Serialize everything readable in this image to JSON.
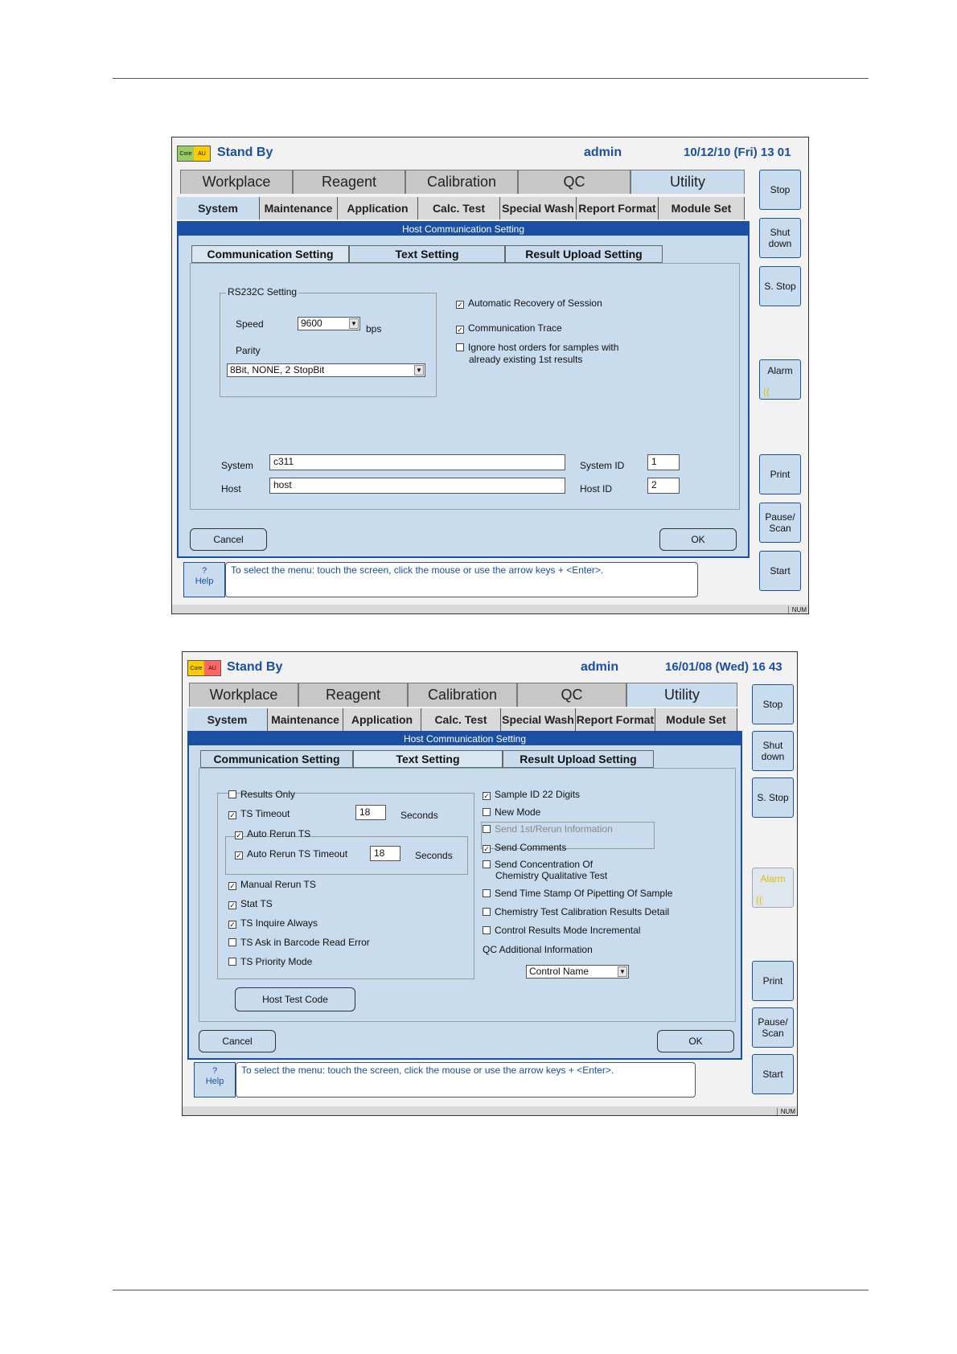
{
  "screen1": {
    "logo": {
      "left": "Core",
      "right": "AU"
    },
    "status": "Stand By",
    "user": "admin",
    "datetime": "10/12/10 (Fri) 13 01",
    "main_tabs": [
      "Workplace",
      "Reagent",
      "Calibration",
      "QC",
      "Utility"
    ],
    "sub_tabs": [
      "System",
      "Maintenance",
      "Application",
      "Calc. Test",
      "Special Wash",
      "Report Format",
      "Module Set"
    ],
    "dialog_title": "Host Communication Setting",
    "dialog_tabs": [
      "Communication Setting",
      "Text Setting",
      "Result Upload Setting"
    ],
    "rs232c": {
      "group_label": "RS232C Setting",
      "speed_label": "Speed",
      "speed_value": "9600",
      "speed_unit": "bps",
      "parity_label": "Parity",
      "parity_value": "8Bit, NONE, 2 StopBit"
    },
    "options": [
      {
        "label": "Automatic Recovery of Session",
        "checked": true
      },
      {
        "label": "Communication Trace",
        "checked": true
      },
      {
        "label": "Ignore host orders for samples with",
        "label2": "already existing 1st results",
        "checked": false
      }
    ],
    "system_label": "System",
    "system_value": "c311",
    "host_label": "Host",
    "host_value": "host",
    "system_id_label": "System ID",
    "system_id_value": "1",
    "host_id_label": "Host ID",
    "host_id_value": "2",
    "cancel_label": "Cancel",
    "ok_label": "OK",
    "help_label": "Help",
    "help_q": "?",
    "message": "To select the menu: touch the screen, click the mouse or use the arrow keys + <Enter>.",
    "side_buttons": [
      "Stop",
      "Shut down",
      "S. Stop",
      "Alarm",
      "Print",
      "Pause/ Scan",
      "Start"
    ],
    "num_indicator": "NUM"
  },
  "screen2": {
    "logo": {
      "left": "Core",
      "right": "AU"
    },
    "status": "Stand By",
    "user": "admin",
    "datetime": "16/01/08 (Wed) 16 43",
    "main_tabs": [
      "Workplace",
      "Reagent",
      "Calibration",
      "QC",
      "Utility"
    ],
    "sub_tabs": [
      "System",
      "Maintenance",
      "Application",
      "Calc. Test",
      "Special Wash",
      "Report Format",
      "Module Set"
    ],
    "dialog_title": "Host Communication Setting",
    "dialog_tabs": [
      "Communication Setting",
      "Text Setting",
      "Result Upload Setting"
    ],
    "left_options": {
      "results_only": {
        "label": "Results Only",
        "checked": false
      },
      "ts_timeout": {
        "label": "TS Timeout",
        "checked": true,
        "value": "18",
        "unit": "Seconds"
      },
      "auto_rerun_ts": {
        "label": "Auto Rerun TS",
        "checked": true
      },
      "auto_rerun_ts_timeout": {
        "label": "Auto Rerun TS Timeout",
        "checked": true,
        "value": "18",
        "unit": "Seconds"
      },
      "manual_rerun_ts": {
        "label": "Manual Rerun TS",
        "checked": true
      },
      "stat_ts": {
        "label": "Stat TS",
        "checked": true
      },
      "ts_inquire_always": {
        "label": "TS Inquire Always",
        "checked": true
      },
      "ts_ask_barcode": {
        "label": "TS Ask in Barcode Read Error",
        "checked": false
      },
      "ts_priority_mode": {
        "label": "TS Priority Mode",
        "checked": false
      }
    },
    "host_test_code_label": "Host Test Code",
    "right_options": {
      "sample_id_22": {
        "label": "Sample ID 22 Digits",
        "checked": true
      },
      "new_mode": {
        "label": "New Mode",
        "checked": false
      },
      "send_1st_rerun": {
        "label": "Send 1st/Rerun Information",
        "checked": false
      },
      "send_comments": {
        "label": "Send Comments",
        "checked": true
      },
      "send_concentration": {
        "label": "Send Concentration Of",
        "label2": "Chemistry Qualitative Test",
        "checked": false
      },
      "send_time_stamp": {
        "label": "Send Time Stamp Of Pipetting Of Sample",
        "checked": false
      },
      "chem_cal_detail": {
        "label": "Chemistry Test Calibration Results Detail",
        "checked": false
      },
      "control_results_incremental": {
        "label": "Control Results Mode Incremental",
        "checked": false
      }
    },
    "qc_additional_label": "QC Additional Information",
    "qc_additional_value": "Control Name",
    "cancel_label": "Cancel",
    "ok_label": "OK",
    "help_label": "Help",
    "help_q": "?",
    "message": "To select the menu: touch the screen, click the mouse or use the arrow keys + <Enter>.",
    "side_buttons": [
      "Stop",
      "Shut down",
      "S. Stop",
      "Alarm",
      "Print",
      "Pause/ Scan",
      "Start"
    ],
    "num_indicator": "NUM"
  }
}
